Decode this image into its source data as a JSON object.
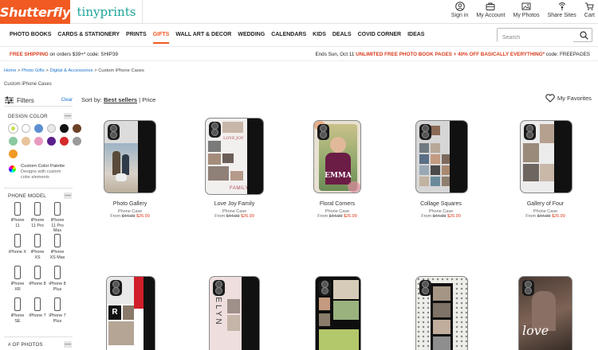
{
  "brand": {
    "primary": "Shutterfly",
    "secondary": "tinyprints",
    "accent": "#f15a22",
    "secondary_color": "#1aa39a"
  },
  "header_links": [
    {
      "label": "Sign in",
      "icon": "user-icon"
    },
    {
      "label": "My Account",
      "icon": "briefcase-icon"
    },
    {
      "label": "My Photos",
      "icon": "image-icon"
    },
    {
      "label": "Share Sites",
      "icon": "share-icon"
    },
    {
      "label": "Cart",
      "icon": "cart-icon"
    }
  ],
  "nav": {
    "items": [
      "PHOTO BOOKS",
      "CARDS & STATIONERY",
      "PRINTS",
      "GIFTS",
      "WALL ART & DECOR",
      "WEDDING",
      "CALENDARS",
      "KIDS",
      "DEALS",
      "COVID CORNER",
      "IDEAS"
    ],
    "active": "GIFTS",
    "search_placeholder": "Search"
  },
  "promo": {
    "left_highlight": "FREE SHIPPING",
    "left_text": " on orders $39+* code: SHIP39",
    "right_prefix": "Ends Sun, Oct 11 ",
    "right_highlight": "UNLIMITED FREE PHOTO BOOK PAGES + 40% OFF BASICALLY EVERYTHING*",
    "right_suffix": " code: FREEPAGES"
  },
  "breadcrumb": {
    "items": [
      "Home",
      "Photo Gifts",
      "Digital & Accessories"
    ],
    "separator": ">",
    "current": "Custom iPhone Cases"
  },
  "page_title": "Custom iPhone Cases",
  "sidebar": {
    "filters_label": "Filters",
    "clear_label": "Clear",
    "design_color_title": "DESIGN COLOR",
    "toggle_symbol": "—",
    "colors": [
      "#c8e04a",
      "#ffffff",
      "#5b8fd0",
      "#e8e8e8",
      "#111111",
      "#6b4226",
      "#8bc9a0",
      "#e8c49a",
      "#e89ac0",
      "#5a1f8c",
      "#d42a2a",
      "#9a9a9a",
      "#f09a25"
    ],
    "custom_palette_title": "Custom Color Palette",
    "custom_palette_desc": "Designs with custom color elements",
    "phone_model_title": "PHONE MODEL",
    "models": [
      "iPhone 11",
      "iPhone 11 Pro",
      "iPhone 11 Pro Max",
      "iPhone X",
      "iPhone XS",
      "iPhone XS Max",
      "iPhone XR",
      "iPhone 8",
      "iPhone 8 Plus",
      "iPhone SE",
      "iPhone 7",
      "iPhone 7 Plus"
    ],
    "photos_title": "# OF PHOTOS"
  },
  "sort": {
    "label": "Sort by:",
    "selected": "Best sellers",
    "separator": "|",
    "other": "Price"
  },
  "favorites_label": "My Favorites",
  "products": [
    {
      "name": "Photo Gallery",
      "type": "Phone Case",
      "from": "From",
      "old_price": "$44.99",
      "price": "$26.99"
    },
    {
      "name": "Love Joy Family",
      "type": "Phone Case",
      "from": "From",
      "old_price": "$44.99",
      "price": "$26.99"
    },
    {
      "name": "Floral Corners",
      "type": "Phone Case",
      "from": "From",
      "old_price": "$44.99",
      "price": "$26.99"
    },
    {
      "name": "Collage Squares",
      "type": "Phone Case",
      "from": "From",
      "old_price": "$44.99",
      "price": "$26.99"
    },
    {
      "name": "Gallery of Four",
      "type": "Phone Case",
      "from": "From",
      "old_price": "$44.99",
      "price": "$26.99"
    },
    {
      "name": "",
      "type": "",
      "from": "",
      "old_price": "",
      "price": ""
    },
    {
      "name": "",
      "type": "",
      "from": "",
      "old_price": "",
      "price": ""
    },
    {
      "name": "",
      "type": "",
      "from": "",
      "old_price": "",
      "price": ""
    },
    {
      "name": "",
      "type": "",
      "from": "",
      "old_price": "",
      "price": ""
    },
    {
      "name": "",
      "type": "",
      "from": "",
      "old_price": "",
      "price": ""
    }
  ],
  "case_art": {
    "family": "FAMILY",
    "love": "LOVE",
    "joy": "JOY",
    "emma": "EMMA",
    "r_letter": "R",
    "evelyn": "EVELYN",
    "love_script": "love"
  }
}
